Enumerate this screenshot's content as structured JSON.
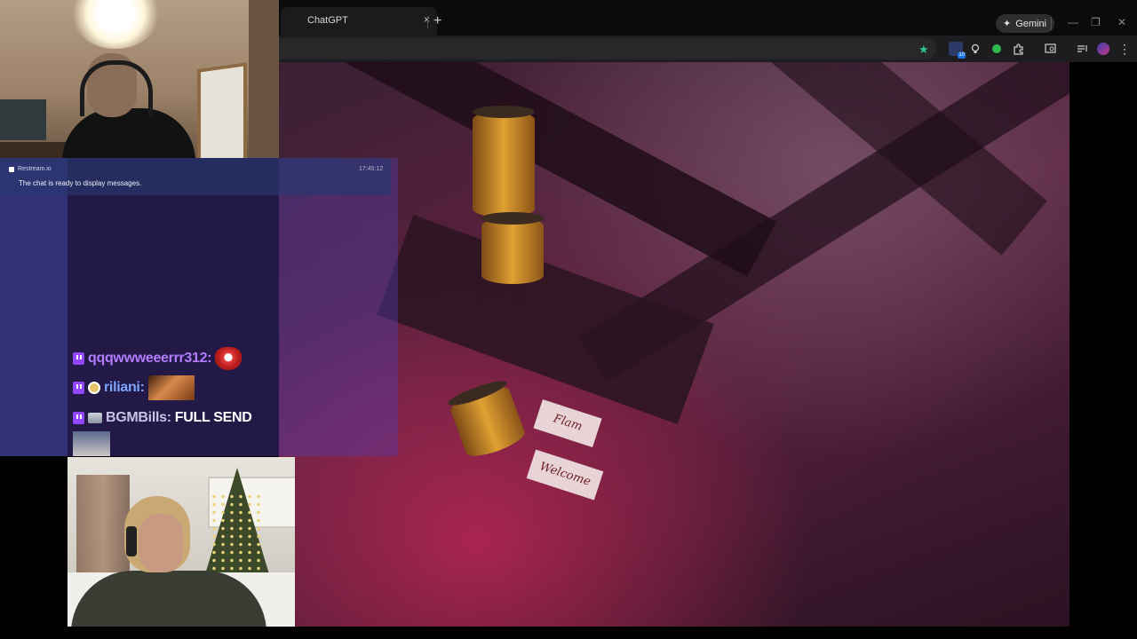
{
  "browser": {
    "tab_title": "ChatGPT",
    "tab_close": "×",
    "new_tab": "+",
    "gemini_label": "Gemini",
    "gemini_icon": "✦",
    "bookmark_icon": "★",
    "minimize": "—",
    "restore": "❐",
    "close": "✕",
    "extension_badge": "10",
    "menu_icon": "⋮",
    "toolbar_icons": [
      "extension-icon",
      "lightbulb-icon",
      "green-extension-icon",
      "puzzle-icon",
      "tab-search-icon",
      "media-icon",
      "profile-avatar",
      "menu-icon"
    ]
  },
  "chat": {
    "source": "Restream.io",
    "time": "17:45:12",
    "ready_message": "The chat is ready to display messages.",
    "messages": [
      {
        "username": "qqqwwweeerrr312:",
        "text": ""
      },
      {
        "username": "riliani:",
        "text": ""
      },
      {
        "username": "BGMBills:",
        "text": "FULL SEND"
      }
    ]
  },
  "game": {
    "label_1": "Flam",
    "label_2": "Welcome"
  },
  "colors": {
    "chat_overlay": "#5a3cad",
    "twitch_purple": "#9146ff",
    "game_tint": "#5a2340"
  }
}
